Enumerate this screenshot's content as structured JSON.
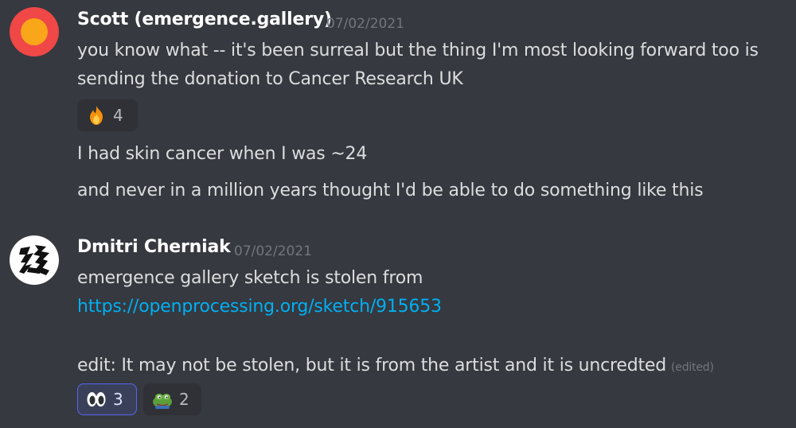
{
  "messages": [
    {
      "author": "Scott (emergence.gallery)",
      "timestamp": "07/02/2021",
      "lines": [
        "you know what -- it's been surreal but the thing I'm most looking forward too is",
        "sending the donation to Cancer Research UK"
      ],
      "reactions": [
        {
          "emoji": "fire-icon",
          "count": "4",
          "selected": false
        }
      ],
      "followups": [
        "I had skin cancer when I was ~24",
        "and never in a million years thought I'd be able to do something like this"
      ]
    },
    {
      "author": "Dmitri Cherniak",
      "timestamp": "07/02/2021",
      "lines": [
        "emergence gallery sketch is stolen from",
        "https://openprocessing.org/sketch/915653",
        "edit: It may not be stolen, but it is from the artist and it is uncredted"
      ],
      "edited_label": "(edited)",
      "reactions": [
        {
          "emoji": "eyes-icon",
          "count": "3",
          "selected": true
        },
        {
          "emoji": "frog-icon",
          "count": "2",
          "selected": false
        }
      ]
    }
  ],
  "colors": {
    "background": "#36393f",
    "username": "#ffffff",
    "text": "#dcddde",
    "timestamp": "#72767d",
    "link": "#00aff4",
    "reaction_selected_border": "#5865f2"
  }
}
